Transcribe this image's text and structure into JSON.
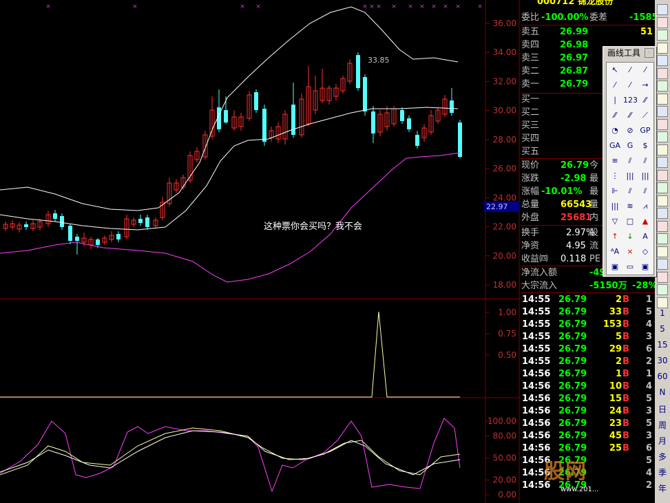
{
  "stock": {
    "code_name": "000712 锦龙股份"
  },
  "chart": {
    "price_axis": [
      "36.00",
      "34.00",
      "32.00",
      "30.00",
      "28.00",
      "26.00",
      "24.00",
      "22.00",
      "20.00",
      "18.00"
    ],
    "vol_axis": [
      "1.00",
      "0.75",
      "0.50"
    ],
    "kdj_axis": [
      "100.00",
      "80.00",
      "50.00",
      "20.00",
      "0.00"
    ],
    "high_label": "33.85",
    "current_price_tag": "22.97",
    "annotation": "这种票你会买吗？我不会",
    "colors": {
      "up": "#ff3030",
      "down": "#54ffff",
      "mid": "#ffffff",
      "lower": "#ff40ff",
      "axis": "#800000"
    }
  },
  "quote": {
    "bid_ratio_label": "委比",
    "bid_ratio": "-100.00%",
    "bid_diff_label": "委差",
    "bid_diff": "-1585",
    "asks": [
      {
        "label": "卖五",
        "price": "26.99",
        "vol": "51"
      },
      {
        "label": "卖四",
        "price": "26.98",
        "vol": ""
      },
      {
        "label": "卖三",
        "price": "26.97",
        "vol": ""
      },
      {
        "label": "卖二",
        "price": "26.87",
        "vol": ""
      },
      {
        "label": "卖一",
        "price": "26.79",
        "vol": ""
      }
    ],
    "bids": [
      {
        "label": "买一"
      },
      {
        "label": "买二"
      },
      {
        "label": "买三"
      },
      {
        "label": "买四"
      },
      {
        "label": "买五"
      }
    ],
    "stats": [
      {
        "label": "现价",
        "value": "26.79",
        "tail": "今"
      },
      {
        "label": "涨跌",
        "value": "-2.98",
        "tail": "最"
      },
      {
        "label": "涨幅",
        "value": "-10.01%",
        "tail": "最"
      },
      {
        "label": "总量",
        "value": "66543",
        "tail": "量"
      },
      {
        "label": "外盘",
        "value": "25681",
        "tail": "内"
      }
    ],
    "fin": [
      {
        "label": "换手",
        "value": "2.97%",
        "tail": "股"
      },
      {
        "label": "净资",
        "value": "4.95",
        "tail": "流"
      },
      {
        "label": "收益㈣",
        "value": "0.118",
        "tail": "PE"
      }
    ],
    "flow": [
      {
        "label": "净流入额",
        "value": "-49"
      },
      {
        "label": "大宗流入",
        "value": "-5150万",
        "pct": "-28%"
      }
    ],
    "ticks": [
      {
        "t": "14:55",
        "p": "26.79",
        "v": "2",
        "f": "B",
        "n": "1"
      },
      {
        "t": "14:55",
        "p": "26.79",
        "v": "33",
        "f": "B",
        "n": "5"
      },
      {
        "t": "14:55",
        "p": "26.79",
        "v": "153",
        "f": "B",
        "n": "4"
      },
      {
        "t": "14:55",
        "p": "26.79",
        "v": "5",
        "f": "B",
        "n": "3"
      },
      {
        "t": "14:55",
        "p": "26.79",
        "v": "29",
        "f": "B",
        "n": "6"
      },
      {
        "t": "14:55",
        "p": "26.79",
        "v": "2",
        "f": "B",
        "n": "2"
      },
      {
        "t": "14:56",
        "p": "26.79",
        "v": "1",
        "f": "B",
        "n": "1"
      },
      {
        "t": "14:56",
        "p": "26.79",
        "v": "10",
        "f": "B",
        "n": "4"
      },
      {
        "t": "14:56",
        "p": "26.79",
        "v": "15",
        "f": "B",
        "n": "5"
      },
      {
        "t": "14:56",
        "p": "26.79",
        "v": "24",
        "f": "B",
        "n": "3"
      },
      {
        "t": "14:56",
        "p": "26.79",
        "v": "23",
        "f": "B",
        "n": "5"
      },
      {
        "t": "14:56",
        "p": "26.79",
        "v": "45",
        "f": "B",
        "n": "3"
      },
      {
        "t": "14:56",
        "p": "26.79",
        "v": "25",
        "f": "B",
        "n": "6"
      },
      {
        "t": "14:56",
        "p": "26.79",
        "v": "",
        "f": "",
        "n": "5"
      },
      {
        "t": "14:56",
        "p": "26.79",
        "v": "",
        "f": "",
        "n": "4"
      },
      {
        "t": "14:56",
        "p": "26.79",
        "v": "",
        "f": "",
        "n": "2"
      }
    ]
  },
  "side": {
    "tabs": [
      "1",
      "5",
      "15",
      "30",
      "60",
      "N",
      "日",
      "周",
      "月",
      "多",
      "季",
      "年"
    ]
  },
  "toolbox": {
    "title": "画线工具",
    "close": "×",
    "tools": [
      "↖",
      "⁄",
      "⁄",
      "⁄",
      "⁄",
      "→",
      "∣",
      "123",
      "⁄⁄",
      "⁄⁄",
      "⁄⁄",
      "⟋",
      "◔",
      "⊘",
      "GP",
      "GA",
      "G",
      "$",
      "≡",
      "⫽",
      "⫽",
      "⋮",
      "|||",
      "|||",
      "⊩",
      "⫽",
      "⫽",
      "|||",
      "≋",
      "⩘",
      "▽",
      "□",
      "▲",
      "↑",
      "↓",
      "A",
      "ᴬA",
      "×",
      "◇",
      "▣",
      "▭",
      "▣"
    ]
  },
  "watermark": {
    "main": "股网",
    "sub": "www.201..."
  }
}
